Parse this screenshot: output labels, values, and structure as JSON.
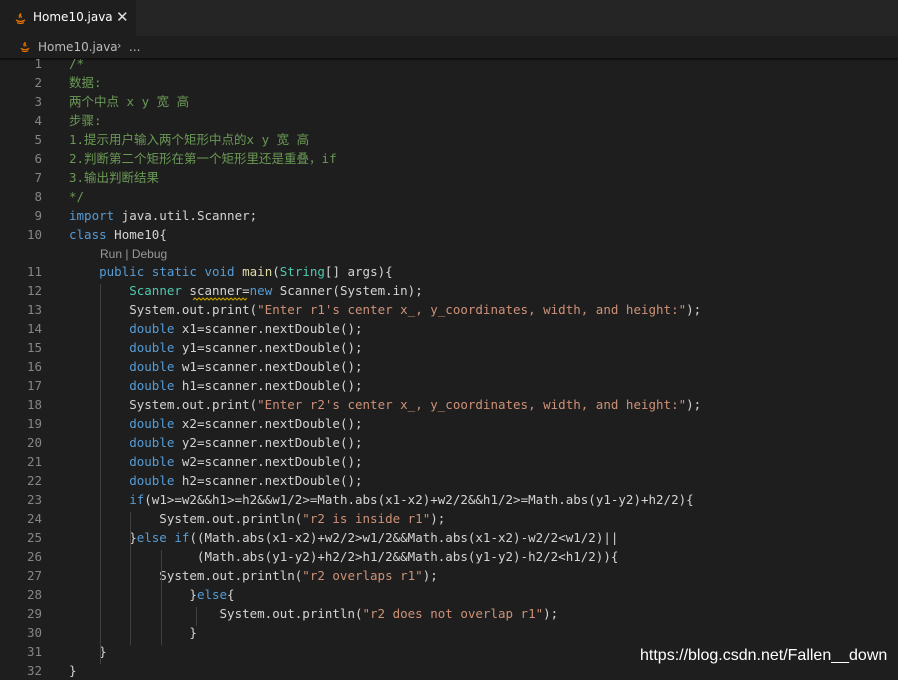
{
  "tab": {
    "title": "Home10.java",
    "close_glyph": "✕",
    "icon": "java-icon"
  },
  "breadcrumb": {
    "file": "Home10.java",
    "separator": "›",
    "symbol": "..."
  },
  "codelens": {
    "run": "Run",
    "sep": " | ",
    "debug": "Debug"
  },
  "watermark": "https://blog.csdn.net/Fallen__down",
  "colors": {
    "comment": "#6a9955",
    "keyword": "#569cd6",
    "type": "#4ec9b0",
    "string": "#ce9178",
    "function": "#dcdcaa",
    "text": "#d4d4d4"
  },
  "code_lines": [
    {
      "n": "1",
      "tokens": [
        [
          "c",
          "/*"
        ]
      ]
    },
    {
      "n": "2",
      "tokens": [
        [
          "c",
          "数据:"
        ]
      ]
    },
    {
      "n": "3",
      "tokens": [
        [
          "c",
          "两个中点 x y 宽 高"
        ]
      ]
    },
    {
      "n": "4",
      "tokens": [
        [
          "c",
          "步骤:"
        ]
      ]
    },
    {
      "n": "5",
      "tokens": [
        [
          "c",
          "1.提示用户输入两个矩形中点的x y 宽 高"
        ]
      ]
    },
    {
      "n": "6",
      "tokens": [
        [
          "c",
          "2.判断第二个矩形在第一个矩形里还是重叠，if"
        ]
      ]
    },
    {
      "n": "7",
      "tokens": [
        [
          "c",
          "3.输出判断结果"
        ]
      ]
    },
    {
      "n": "8",
      "tokens": [
        [
          "c",
          "*/"
        ]
      ]
    },
    {
      "n": "9",
      "tokens": [
        [
          "k",
          "import"
        ],
        [
          "p",
          " java.util.Scanner;"
        ]
      ]
    },
    {
      "n": "10",
      "tokens": [
        [
          "k",
          "class"
        ],
        [
          "p",
          " Home10{"
        ]
      ]
    },
    {
      "n": "11",
      "tokens": [
        [
          "p",
          "    "
        ],
        [
          "k",
          "public"
        ],
        [
          "p",
          " "
        ],
        [
          "k",
          "static"
        ],
        [
          "p",
          " "
        ],
        [
          "k",
          "void"
        ],
        [
          "p",
          " "
        ],
        [
          "f",
          "main"
        ],
        [
          "p",
          "("
        ],
        [
          "t",
          "String"
        ],
        [
          "p",
          "[] args){"
        ]
      ]
    },
    {
      "n": "12",
      "tokens": [
        [
          "p",
          "        "
        ],
        [
          "t",
          "Scanner"
        ],
        [
          "p",
          " scanner="
        ],
        [
          "k",
          "new"
        ],
        [
          "p",
          " Scanner(System.in);"
        ]
      ]
    },
    {
      "n": "13",
      "tokens": [
        [
          "p",
          "        System.out.print("
        ],
        [
          "s",
          "\"Enter r1's center x_, y_coordinates, width, and height:\""
        ],
        [
          "p",
          ");"
        ]
      ]
    },
    {
      "n": "14",
      "tokens": [
        [
          "p",
          "        "
        ],
        [
          "k",
          "double"
        ],
        [
          "p",
          " x1=scanner.nextDouble();"
        ]
      ]
    },
    {
      "n": "15",
      "tokens": [
        [
          "p",
          "        "
        ],
        [
          "k",
          "double"
        ],
        [
          "p",
          " y1=scanner.nextDouble();"
        ]
      ]
    },
    {
      "n": "16",
      "tokens": [
        [
          "p",
          "        "
        ],
        [
          "k",
          "double"
        ],
        [
          "p",
          " w1=scanner.nextDouble();"
        ]
      ]
    },
    {
      "n": "17",
      "tokens": [
        [
          "p",
          "        "
        ],
        [
          "k",
          "double"
        ],
        [
          "p",
          " h1=scanner.nextDouble();"
        ]
      ]
    },
    {
      "n": "18",
      "tokens": [
        [
          "p",
          "        System.out.print("
        ],
        [
          "s",
          "\"Enter r2's center x_, y_coordinates, width, and height:\""
        ],
        [
          "p",
          ");"
        ]
      ]
    },
    {
      "n": "19",
      "tokens": [
        [
          "p",
          "        "
        ],
        [
          "k",
          "double"
        ],
        [
          "p",
          " x2=scanner.nextDouble();"
        ]
      ]
    },
    {
      "n": "20",
      "tokens": [
        [
          "p",
          "        "
        ],
        [
          "k",
          "double"
        ],
        [
          "p",
          " y2=scanner.nextDouble();"
        ]
      ]
    },
    {
      "n": "21",
      "tokens": [
        [
          "p",
          "        "
        ],
        [
          "k",
          "double"
        ],
        [
          "p",
          " w2=scanner.nextDouble();"
        ]
      ]
    },
    {
      "n": "22",
      "tokens": [
        [
          "p",
          "        "
        ],
        [
          "k",
          "double"
        ],
        [
          "p",
          " h2=scanner.nextDouble();"
        ]
      ]
    },
    {
      "n": "23",
      "tokens": [
        [
          "p",
          "        "
        ],
        [
          "k",
          "if"
        ],
        [
          "p",
          "(w1>=w2&&h1>=h2&&w1/2>=Math.abs(x1-x2)+w2/2&&h1/2>=Math.abs(y1-y2)+h2/2){"
        ]
      ]
    },
    {
      "n": "24",
      "tokens": [
        [
          "p",
          "            System.out.println("
        ],
        [
          "s",
          "\"r2 is inside r1\""
        ],
        [
          "p",
          ");"
        ]
      ]
    },
    {
      "n": "25",
      "tokens": [
        [
          "p",
          "        }"
        ],
        [
          "k",
          "else"
        ],
        [
          "p",
          " "
        ],
        [
          "k",
          "if"
        ],
        [
          "p",
          "((Math.abs(x1-x2)+w2/2>w1/2&&Math.abs(x1-x2)-w2/2<w1/2)||"
        ]
      ]
    },
    {
      "n": "26",
      "tokens": [
        [
          "p",
          "                 (Math.abs(y1-y2)+h2/2>h1/2&&Math.abs(y1-y2)-h2/2<h1/2)){"
        ]
      ]
    },
    {
      "n": "27",
      "tokens": [
        [
          "p",
          "            System.out.println("
        ],
        [
          "s",
          "\"r2 overlaps r1\""
        ],
        [
          "p",
          ");"
        ]
      ]
    },
    {
      "n": "28",
      "tokens": [
        [
          "p",
          "                }"
        ],
        [
          "k",
          "else"
        ],
        [
          "p",
          "{"
        ]
      ]
    },
    {
      "n": "29",
      "tokens": [
        [
          "p",
          "                    System.out.println("
        ],
        [
          "s",
          "\"r2 does not overlap r1\""
        ],
        [
          "p",
          ");"
        ]
      ]
    },
    {
      "n": "30",
      "tokens": [
        [
          "p",
          "                }"
        ]
      ]
    },
    {
      "n": "31",
      "tokens": [
        [
          "p",
          "    }"
        ]
      ]
    },
    {
      "n": "32",
      "tokens": [
        [
          "p",
          "}"
        ]
      ]
    }
  ]
}
